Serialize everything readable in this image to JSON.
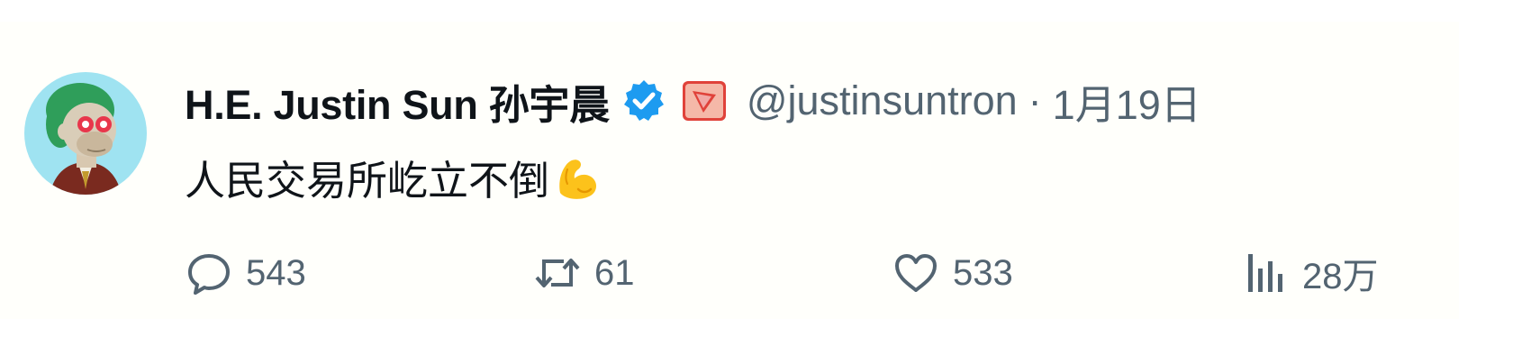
{
  "tweet": {
    "author": {
      "display_name": "H.E. Justin Sun 孙宇晨",
      "handle": "@justinsuntron",
      "verified": true,
      "avatar_icon": "ape-avatar-icon",
      "affiliate_icon": "tron-affiliate-badge-icon"
    },
    "separator": "·",
    "timestamp": "1月19日",
    "text": "人民交易所屹立不倒",
    "text_emoji": "flexed-biceps-icon",
    "actions": {
      "reply_count": "543",
      "retweet_count": "61",
      "like_count": "533",
      "view_count": "28万"
    }
  },
  "colors": {
    "name": "#0f1419",
    "secondary": "#536471",
    "verified_blue": "#1d9bf0",
    "affiliate_red": "#e0423a"
  }
}
